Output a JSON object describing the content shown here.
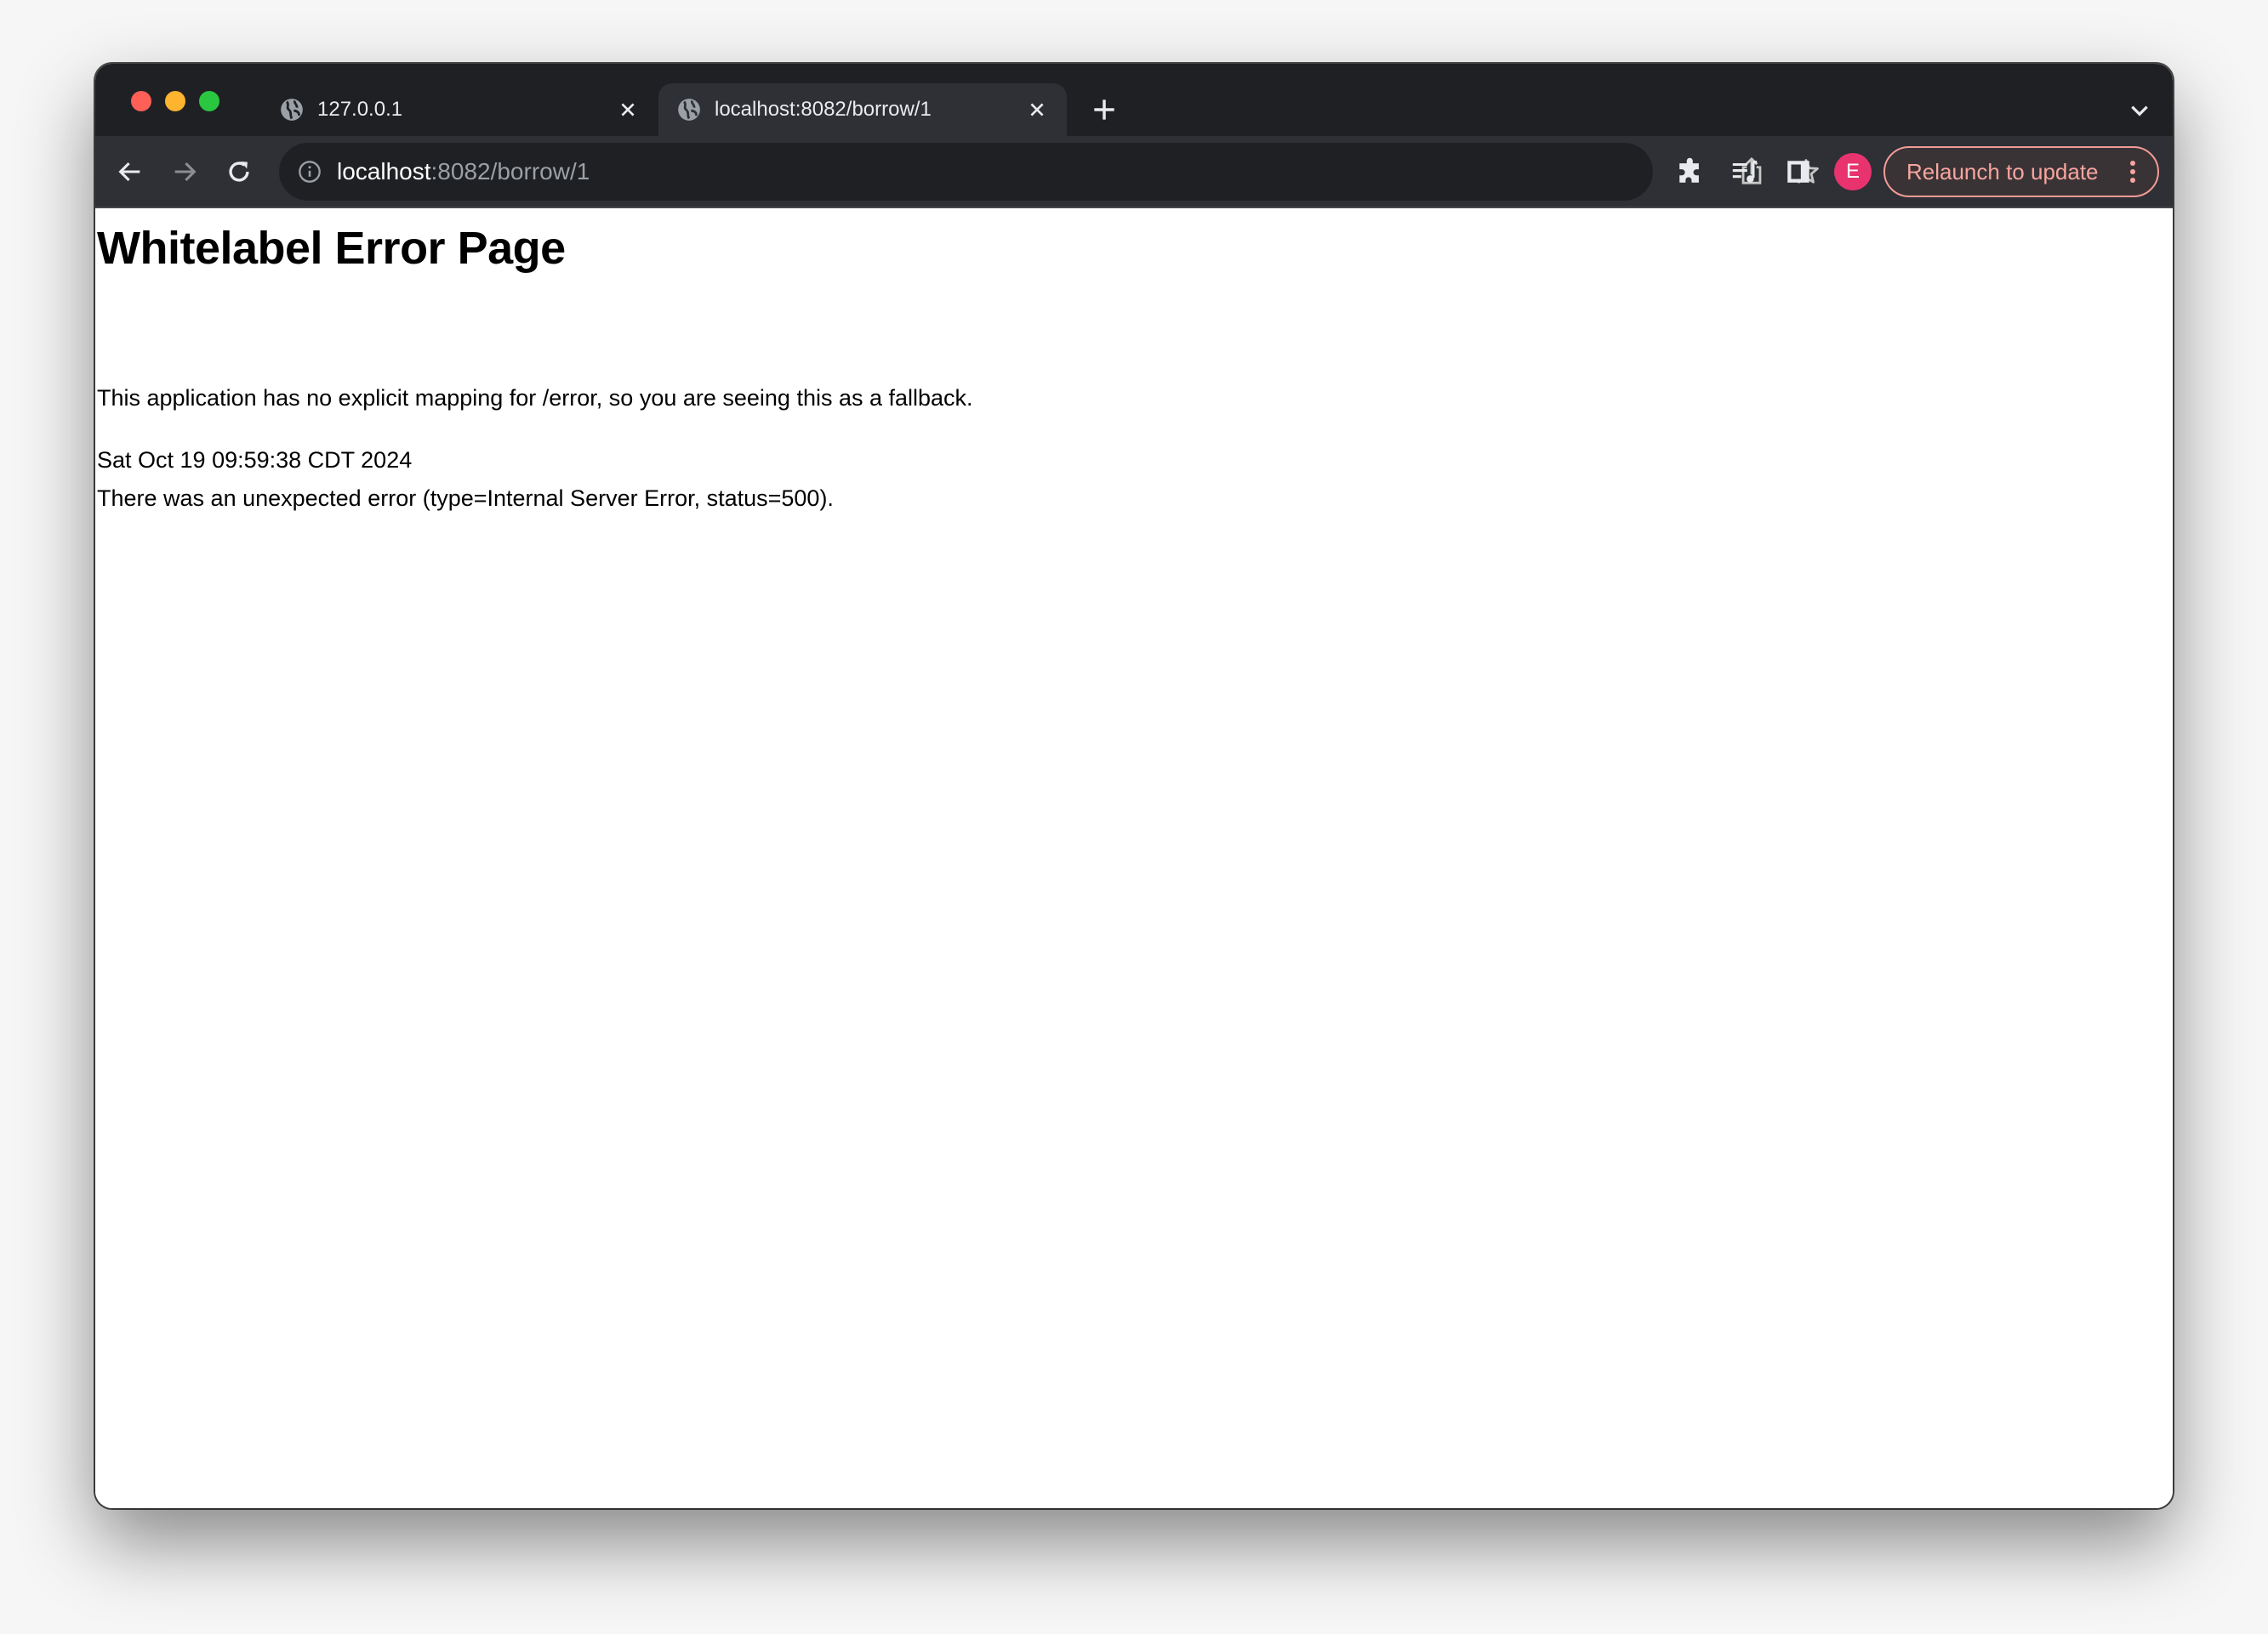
{
  "browser": {
    "tabs": [
      {
        "title": "127.0.0.1",
        "active": false,
        "icon": "globe-icon"
      },
      {
        "title": "localhost:8082/borrow/1",
        "active": true,
        "icon": "globe-icon"
      }
    ],
    "address_bar": {
      "host": "localhost",
      "path": ":8082/borrow/1"
    },
    "profile_initial": "E",
    "relaunch_label": "Relaunch to update",
    "colors": {
      "profile": "#e8336e",
      "relaunch_text": "#f7a59e",
      "tabstrip": "#1f2023",
      "toolbar": "#2e3035"
    }
  },
  "page": {
    "heading": "Whitelabel Error Page",
    "message": "This application has no explicit mapping for /error, so you are seeing this as a fallback.",
    "timestamp": "Sat Oct 19 09:59:38 CDT 2024",
    "error_detail": "There was an unexpected error (type=Internal Server Error, status=500)."
  }
}
